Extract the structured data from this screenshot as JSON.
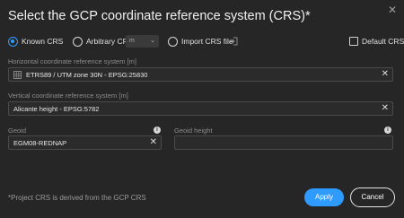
{
  "dialog": {
    "title": "Select the GCP coordinate reference system (CRS)*",
    "close_glyph": "✕"
  },
  "options": {
    "known_crs": {
      "label": "Known CRS",
      "checked": true
    },
    "arbitrary_crs": {
      "label": "Arbitrary CRS",
      "checked": false,
      "unit_value": "m",
      "unit_chevron": "⌄"
    },
    "import_crs_file": {
      "label": "Import CRS file",
      "checked": false
    },
    "default_crs": {
      "label": "Default CRS",
      "checked": false
    }
  },
  "horizontal": {
    "label": "Horizontal coordinate reference system [m]",
    "value": "ETRS89 / UTM zone 30N - EPSG:25830",
    "clear_glyph": "✕"
  },
  "vertical": {
    "label": "Vertical coordinate reference system [m]",
    "value": "Alicante height - EPSG:5782",
    "clear_glyph": "✕"
  },
  "geoid": {
    "label": "Geoid",
    "value": "EGM08-REDNAP",
    "clear_glyph": "✕",
    "info_glyph": "i"
  },
  "geoid_height": {
    "label": "Geoid height",
    "value": "",
    "info_glyph": "i"
  },
  "footer": {
    "note": "*Project CRS is derived from the GCP CRS",
    "apply_label": "Apply",
    "cancel_label": "Cancel"
  },
  "colors": {
    "accent": "#2f9bff",
    "background": "#262626",
    "field_border": "#4a4a4a"
  }
}
